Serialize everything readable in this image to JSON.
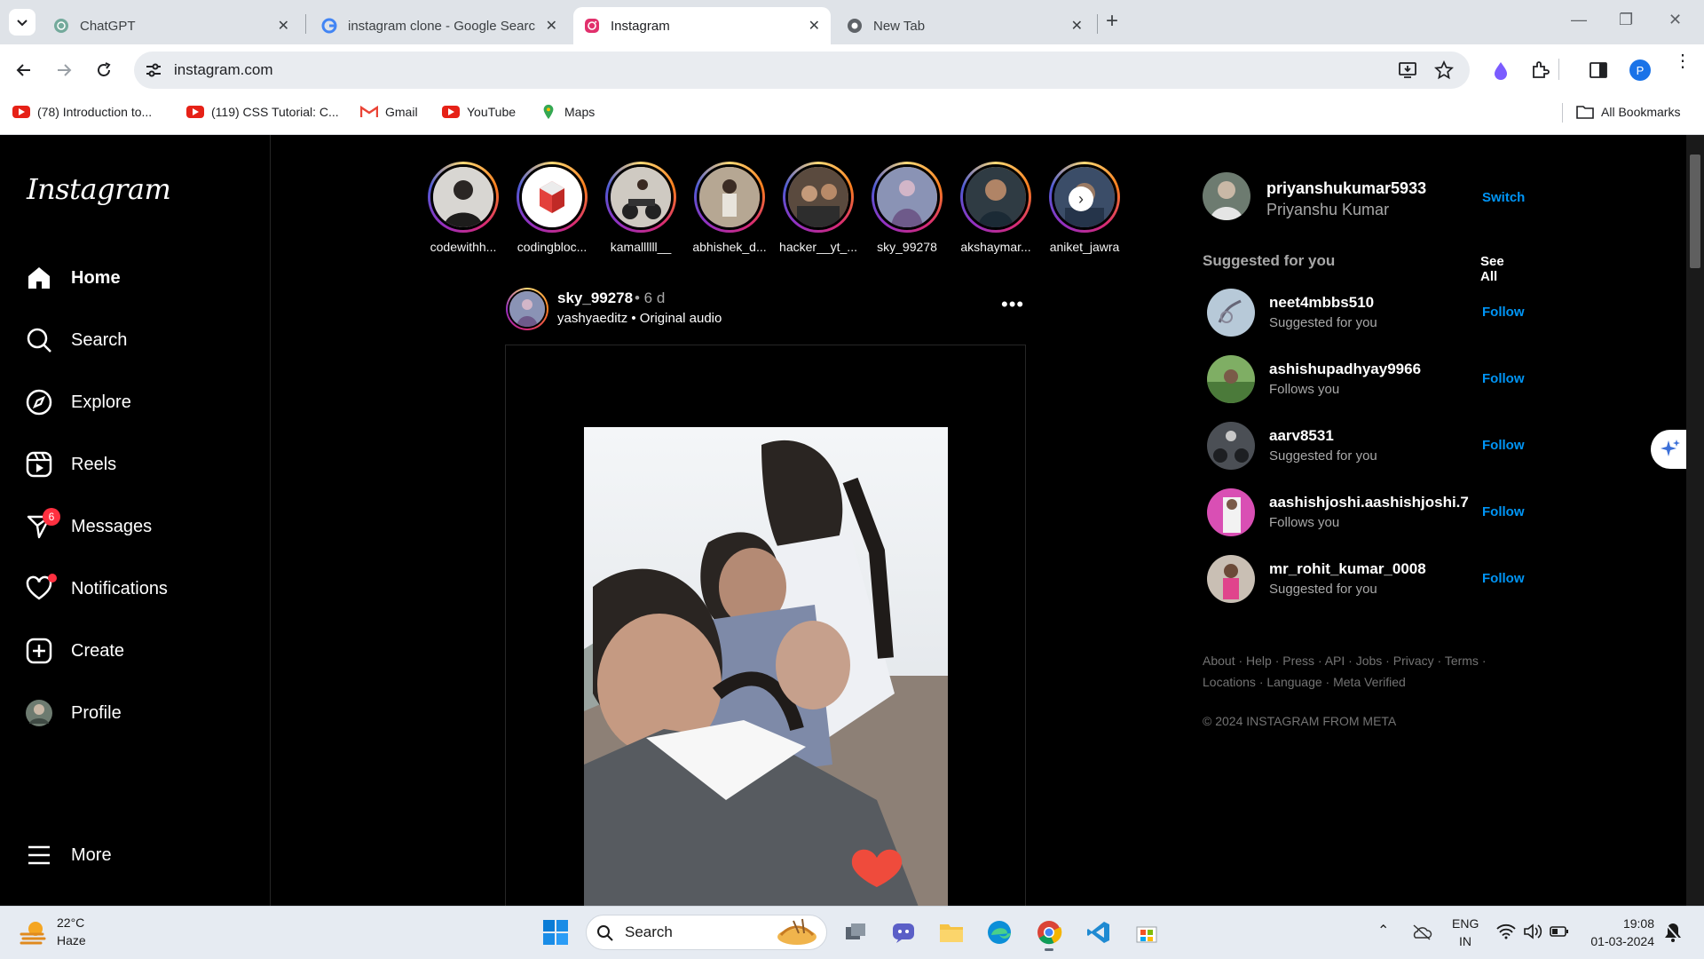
{
  "browser": {
    "tabs": [
      {
        "title": "ChatGPT",
        "favicon": "chatgpt-icon"
      },
      {
        "title": "instagram clone - Google Searc",
        "favicon": "google-icon"
      },
      {
        "title": "Instagram",
        "favicon": "instagram-icon",
        "active": true
      },
      {
        "title": "New Tab",
        "favicon": "chrome-icon"
      }
    ],
    "url": "instagram.com",
    "profile_initial": "P",
    "bookmarks": [
      {
        "label": "(78) Introduction to...",
        "icon": "youtube-icon"
      },
      {
        "label": "(119) CSS Tutorial: C...",
        "icon": "youtube-icon"
      },
      {
        "label": "Gmail",
        "icon": "gmail-icon"
      },
      {
        "label": "YouTube",
        "icon": "youtube-icon"
      },
      {
        "label": "Maps",
        "icon": "maps-icon"
      }
    ],
    "all_bookmarks": "All Bookmarks"
  },
  "sidebar": {
    "logo": "Instagram",
    "items": [
      {
        "label": "Home",
        "icon": "home-icon"
      },
      {
        "label": "Search",
        "icon": "search-icon"
      },
      {
        "label": "Explore",
        "icon": "compass-icon"
      },
      {
        "label": "Reels",
        "icon": "reels-icon"
      },
      {
        "label": "Messages",
        "icon": "messenger-icon",
        "badge": "6"
      },
      {
        "label": "Notifications",
        "icon": "heart-icon"
      },
      {
        "label": "Create",
        "icon": "plus-square-icon"
      },
      {
        "label": "Profile",
        "icon": "avatar"
      }
    ],
    "more": "More"
  },
  "stories": [
    "codewithh...",
    "codingbloc...",
    "kamallllll__",
    "abhishek_d...",
    "hacker__yt_...",
    "sky_99278",
    "akshaymar...",
    "aniket_jawra"
  ],
  "post": {
    "username": "sky_99278",
    "time": "• 6 d",
    "subline": "yashyaeditz • Original audio",
    "more": "•••"
  },
  "rail": {
    "me_username": "priyanshukumar5933",
    "me_name": "Priyanshu Kumar",
    "switch": "Switch",
    "suggested_title": "Suggested for you",
    "see_all": "See All",
    "suggestions": [
      {
        "username": "neet4mbbs510",
        "sub": "Suggested for you",
        "action": "Follow"
      },
      {
        "username": "ashishupadhyay9966",
        "sub": "Follows you",
        "action": "Follow"
      },
      {
        "username": "aarv8531",
        "sub": "Suggested for you",
        "action": "Follow"
      },
      {
        "username": "aashishjoshi.aashishjoshi.7",
        "sub": "Follows you",
        "action": "Follow"
      },
      {
        "username": "mr_rohit_kumar_0008",
        "sub": "Suggested for you",
        "action": "Follow"
      }
    ],
    "footer_line1": "About · Help · Press · API · Jobs · Privacy · Terms ·",
    "footer_line2": "Locations · Language · Meta Verified",
    "copyright": "© 2024 INSTAGRAM FROM META"
  },
  "taskbar": {
    "temperature": "22°C",
    "condition": "Haze",
    "search": "Search",
    "lang1": "ENG",
    "lang2": "IN",
    "time": "19:08",
    "date": "01-03-2024"
  }
}
